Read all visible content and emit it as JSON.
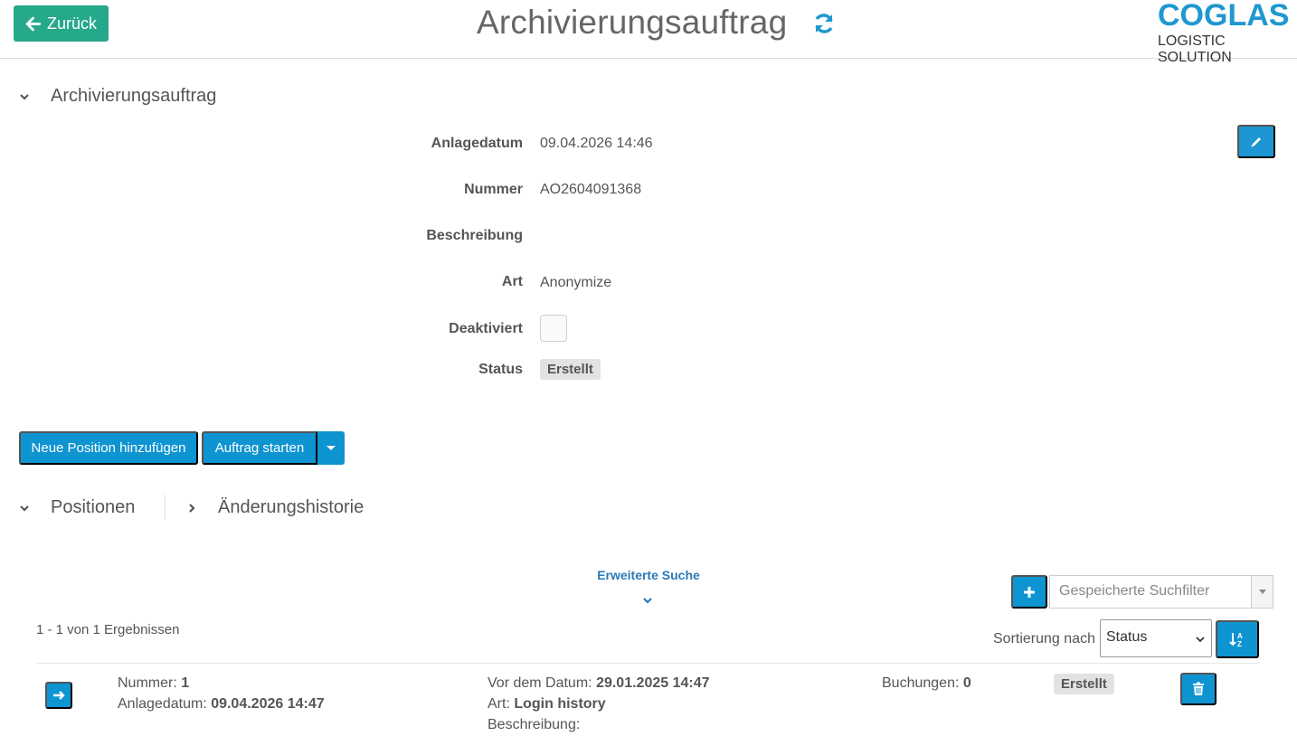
{
  "header": {
    "back_label": "Zurück",
    "title": "Archivierungsauftrag",
    "logo_main": "COGLAS",
    "logo_sub": "LOGISTIC SOLUTION",
    "icons": {
      "back": "arrow-left-icon",
      "refresh": "refresh-icon"
    }
  },
  "details": {
    "section_title": "Archivierungsauftrag",
    "fields": {
      "created": {
        "label": "Anlagedatum",
        "value": "09.04.2026 14:46"
      },
      "number": {
        "label": "Nummer",
        "value": "AO2604091368"
      },
      "description": {
        "label": "Beschreibung",
        "value": ""
      },
      "type": {
        "label": "Art",
        "value": "Anonymize"
      },
      "disabled": {
        "label": "Deaktiviert",
        "checked": false
      },
      "status": {
        "label": "Status",
        "value": "Erstellt"
      }
    }
  },
  "actions": {
    "add_position": "Neue Position hinzufügen",
    "start_order": "Auftrag starten"
  },
  "tabs": {
    "positions": "Positionen",
    "history": "Änderungshistorie"
  },
  "search": {
    "advanced": "Erweiterte Suche",
    "saved_filter_placeholder": "Gespeicherte Suchfilter",
    "result_count": "1 - 1 von 1 Ergebnissen",
    "sort_label": "Sortierung nach",
    "sort_value": "Status"
  },
  "rows": [
    {
      "number_label": "Nummer:",
      "number_value": "1",
      "created_label": "Anlagedatum:",
      "created_value": "09.04.2026 14:47",
      "before_label": "Vor dem Datum:",
      "before_value": "29.01.2025 14:47",
      "type_label": "Art:",
      "type_value": "Login history",
      "description_label": "Beschreibung:",
      "description_value": "",
      "bookings_label": "Buchungen:",
      "bookings_value": "0",
      "status": "Erstellt"
    }
  ],
  "colors": {
    "green": "#26a88a",
    "blue": "#0f94d2",
    "logo_blue": "#1f98cf",
    "link_blue": "#2a79b8"
  }
}
